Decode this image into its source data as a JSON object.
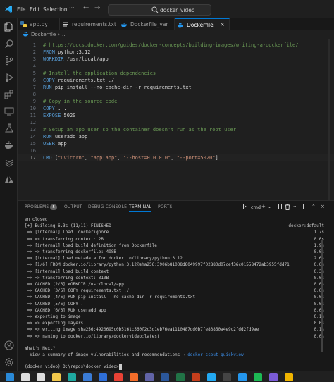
{
  "menu": [
    "File",
    "Edit",
    "Selection"
  ],
  "search": {
    "text": "docker_video"
  },
  "tabs": [
    {
      "label": "app.py",
      "icon": "python-file-icon",
      "color": "#3572a5"
    },
    {
      "label": "requirements.txt",
      "icon": "text-file-icon",
      "color": "#cccccc"
    },
    {
      "label": "Dockerfile_var",
      "icon": "docker-file-icon",
      "color": "#2496ed"
    },
    {
      "label": "Dockerfile",
      "icon": "docker-file-icon",
      "color": "#2496ed"
    }
  ],
  "breadcrumb": {
    "file": "Dockerfile",
    "symbol": "..."
  },
  "editor": {
    "lines": [
      {
        "n": "1",
        "parts": [
          [
            "c-com",
            "# https://docs.docker.com/guides/docker-concepts/building-images/writing-a-dockerfile/"
          ]
        ]
      },
      {
        "n": "2",
        "parts": [
          [
            "c-kw",
            "FROM "
          ],
          [
            "c-def",
            "python:3.12"
          ]
        ]
      },
      {
        "n": "3",
        "parts": [
          [
            "c-kw",
            "WORKDIR "
          ],
          [
            "c-def",
            "/usr/local/app"
          ]
        ]
      },
      {
        "n": "4",
        "parts": []
      },
      {
        "n": "5",
        "parts": [
          [
            "c-com",
            "# Install the application dependencies"
          ]
        ]
      },
      {
        "n": "6",
        "parts": [
          [
            "c-kw",
            "COPY "
          ],
          [
            "c-def",
            "requirements.txt ./"
          ]
        ]
      },
      {
        "n": "7",
        "parts": [
          [
            "c-kw",
            "RUN "
          ],
          [
            "c-def",
            "pip install --no-cache-dir -r requirements.txt"
          ]
        ]
      },
      {
        "n": "8",
        "parts": []
      },
      {
        "n": "9",
        "parts": [
          [
            "c-com",
            "# Copy in the source code"
          ]
        ]
      },
      {
        "n": "10",
        "parts": [
          [
            "c-kw",
            "COPY "
          ],
          [
            "c-def",
            ". ."
          ]
        ]
      },
      {
        "n": "11",
        "parts": [
          [
            "c-kw",
            "EXPOSE "
          ],
          [
            "c-def",
            "5020"
          ]
        ]
      },
      {
        "n": "12",
        "parts": []
      },
      {
        "n": "13",
        "parts": [
          [
            "c-com",
            "# Setup an app user so the container doesn't run as the root user"
          ]
        ]
      },
      {
        "n": "14",
        "parts": [
          [
            "c-kw",
            "RUN "
          ],
          [
            "c-def",
            "useradd app"
          ]
        ]
      },
      {
        "n": "15",
        "parts": [
          [
            "c-kw",
            "USER "
          ],
          [
            "c-def",
            "app"
          ]
        ]
      },
      {
        "n": "16",
        "parts": []
      },
      {
        "n": "17",
        "parts": [
          [
            "c-kw",
            "CMD "
          ],
          [
            "c-def",
            "["
          ],
          [
            "c-str",
            "\"uvicorn\""
          ],
          [
            "c-def",
            ", "
          ],
          [
            "c-str",
            "\"app:app\""
          ],
          [
            "c-def",
            ", "
          ],
          [
            "c-str",
            "\"--host=0.0.0.0\""
          ],
          [
            "c-def",
            ", "
          ],
          [
            "c-str",
            "\"--port=5020\""
          ],
          [
            "c-def",
            "]"
          ]
        ]
      }
    ]
  },
  "panel": {
    "tabs": [
      "PROBLEMS",
      "OUTPUT",
      "DEBUG CONSOLE",
      "TERMINAL",
      "PORTS"
    ],
    "problems_count": "5",
    "shell": "cmd"
  },
  "terminal": {
    "lines": [
      {
        "l": "en closed",
        "r": ""
      },
      {
        "l": "[+] Building 6.3s (11/11) FINISHED",
        "r": "docker:default"
      },
      {
        "l": " => [internal] load .dockerignore",
        "r": "1.7s"
      },
      {
        "l": " => => transferring context: 2B",
        "r": "0.0s"
      },
      {
        "l": " => [internal] load build definition from Dockerfile",
        "r": "1.9s"
      },
      {
        "l": " => => transferring dockerfile: 498B",
        "r": "0.0s"
      },
      {
        "l": " => [internal] load metadata for docker.io/library/python:3.12",
        "r": "2.6s"
      },
      {
        "l": " => [1/6] FROM docker.io/library/python:3.12@sha256:3906b81008d8049997f02880d07cef36c01558472ab3955fdd71",
        "r": "0.0s"
      },
      {
        "l": " => [internal] load build context",
        "r": "0.3s"
      },
      {
        "l": " => => transferring context: 310B",
        "r": "0.0s"
      },
      {
        "l": " => CACHED [2/6] WORKDIR /usr/local/app",
        "r": "0.0s"
      },
      {
        "l": " => CACHED [3/6] COPY requirements.txt ./",
        "r": "0.0s"
      },
      {
        "l": " => CACHED [4/6] RUN pip install --no-cache-dir -r requirements.txt",
        "r": "0.0s"
      },
      {
        "l": " => CACHED [5/6] COPY . .",
        "r": "0.0s"
      },
      {
        "l": " => CACHED [6/6] RUN useradd app",
        "r": "0.0s"
      },
      {
        "l": " => exporting to image",
        "r": "0.1s"
      },
      {
        "l": " => => exporting layers",
        "r": "0.0s"
      },
      {
        "l": " => => writing image sha256:4920695c0b5161c560f2c3d1eb76ea1110487dd0b7fe83850a4e9c2fdd2fd9ae",
        "r": "0.1s"
      },
      {
        "l": " => => naming to docker.io/library/dockervideo:latest",
        "r": "0.0s"
      }
    ],
    "whats_next": "What's Next?",
    "hint_prefix": "  View a summary of image vulnerabilities and recommendations → ",
    "hint_cmd": "docker scout quickview",
    "prompt": "(docker_video) D:\\repos\\docker_video>"
  },
  "taskbar": {
    "apps": [
      {
        "name": "windows-start-icon",
        "color": "#2a8ad8"
      },
      {
        "name": "search-icon",
        "color": "#dddddd"
      },
      {
        "name": "task-view-icon",
        "color": "#dddddd"
      },
      {
        "name": "explorer-icon",
        "color": "#f2c84b"
      },
      {
        "name": "edge-icon",
        "color": "#1fa8a0"
      },
      {
        "name": "store-icon",
        "color": "#3a7bd5"
      },
      {
        "name": "mail-icon",
        "color": "#2f6fd8"
      },
      {
        "name": "chrome-icon",
        "color": "#e94235"
      },
      {
        "name": "firefox-icon",
        "color": "#f36d2a"
      },
      {
        "name": "teams-icon",
        "color": "#6264a7"
      },
      {
        "name": "word-icon",
        "color": "#2b579a"
      },
      {
        "name": "excel-icon",
        "color": "#217346"
      },
      {
        "name": "powerpoint-icon",
        "color": "#c43e1c"
      },
      {
        "name": "vscode-icon",
        "color": "#23a9f2"
      },
      {
        "name": "terminal-icon",
        "color": "#444444"
      },
      {
        "name": "docker-icon",
        "color": "#2496ed"
      },
      {
        "name": "spotify-icon",
        "color": "#1db954"
      },
      {
        "name": "photos-icon",
        "color": "#7a5bd6"
      },
      {
        "name": "notes-icon",
        "color": "#f0b400"
      }
    ]
  }
}
